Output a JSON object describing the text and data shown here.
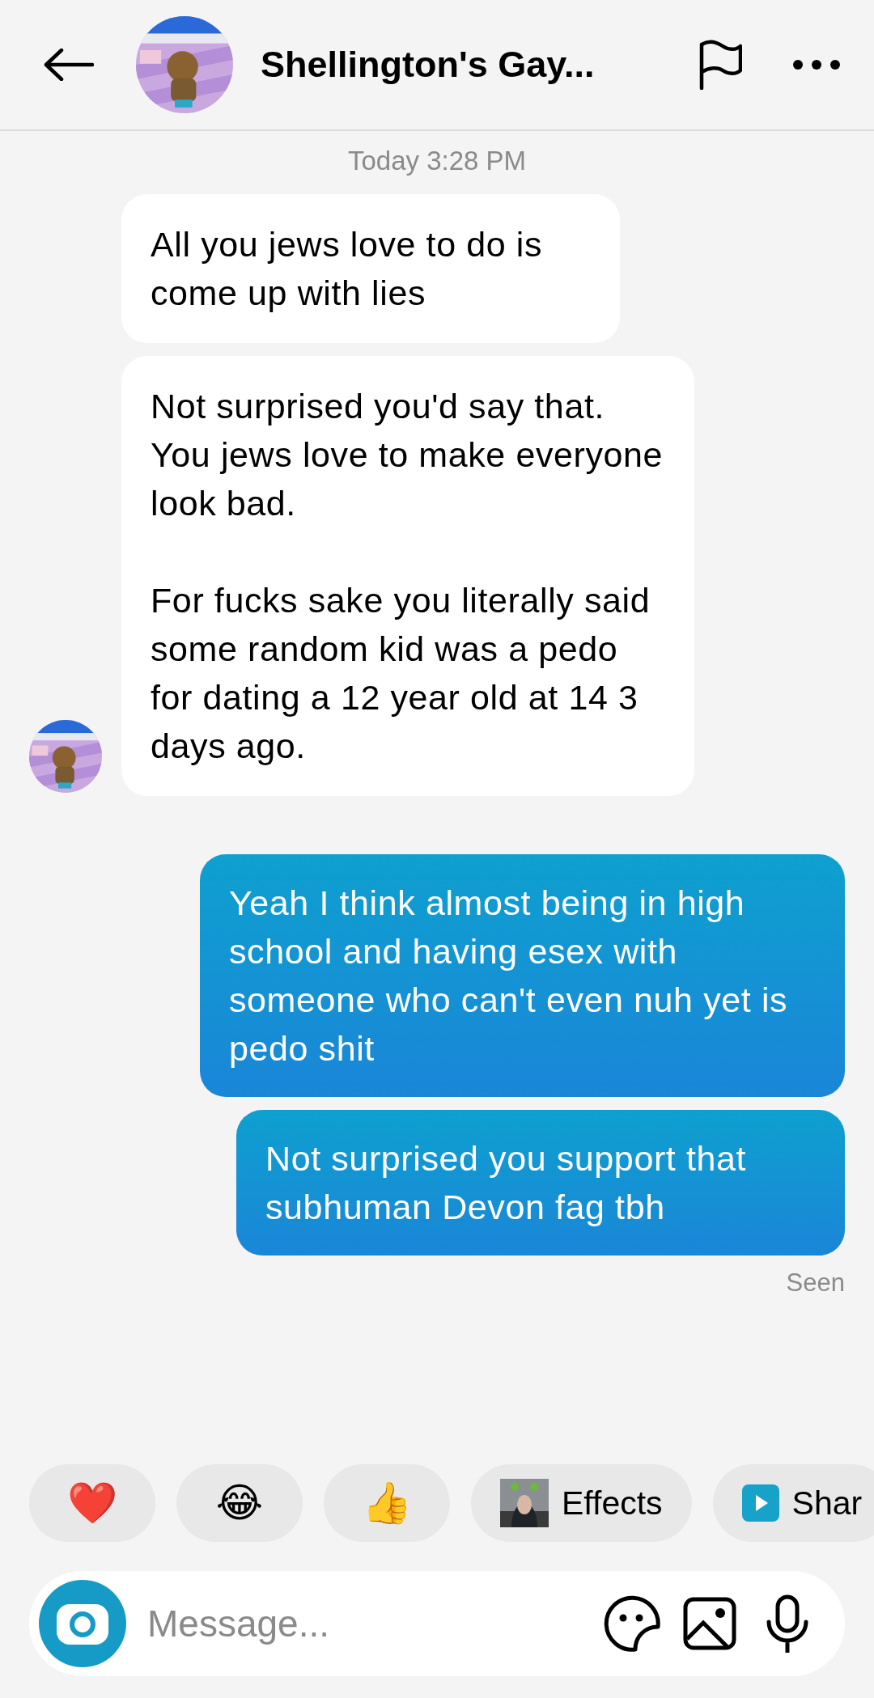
{
  "header": {
    "title": "Shellington's Gay..."
  },
  "timestamp": "Today 3:28 PM",
  "messages": [
    {
      "kind": "received",
      "text": "All you jews love to do is come up with lies",
      "show_avatar": false
    },
    {
      "kind": "received",
      "text": "Not surprised you'd say that. You jews love to make everyone look bad.\n\nFor fucks sake you literally said some random kid was a pedo for dating a 12 year old at 14 3 days ago.",
      "show_avatar": true
    },
    {
      "kind": "sent",
      "text": "Yeah I think almost being in high school and having esex with someone who can't even nuh yet is pedo shit"
    },
    {
      "kind": "sent",
      "text": "Not surprised you support that subhuman Devon fag tbh"
    }
  ],
  "status": "Seen",
  "quick_replies": [
    {
      "kind": "emoji",
      "label": "❤️"
    },
    {
      "kind": "emoji",
      "label": "😂"
    },
    {
      "kind": "emoji",
      "label": "👍"
    },
    {
      "kind": "effects",
      "label": "Effects"
    },
    {
      "kind": "share",
      "label": "Shar"
    }
  ],
  "composer": {
    "placeholder": "Message..."
  }
}
